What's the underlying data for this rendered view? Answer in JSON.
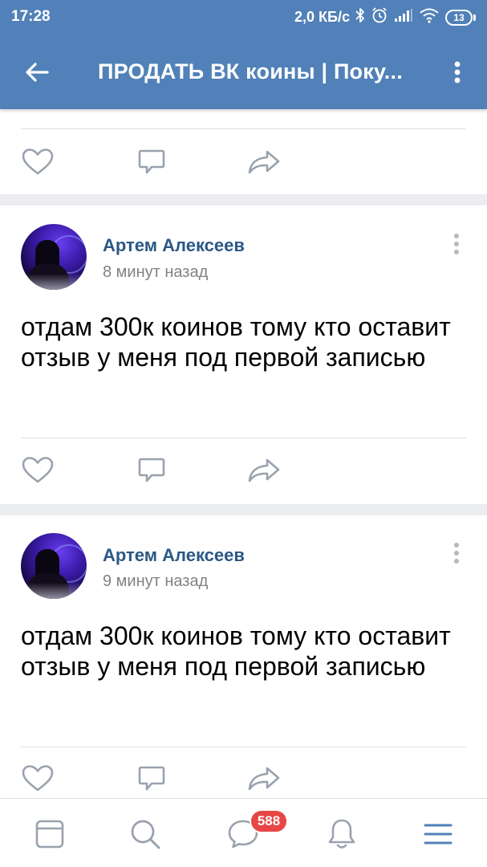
{
  "status_bar": {
    "time": "17:28",
    "network_speed": "2,0 КБ/с",
    "battery_level": "13",
    "icons": [
      "bluetooth-icon",
      "alarm-icon",
      "signal-icon",
      "wifi-icon",
      "battery-icon"
    ]
  },
  "app_bar": {
    "back_icon": "arrow-left-icon",
    "title": "ПРОДАТЬ ВК коины | Поку...",
    "menu_icon": "more-vertical-icon"
  },
  "colors": {
    "app_bar": "#5181b8",
    "author_link": "#2a5885",
    "secondary_text": "#828282",
    "icon_gray": "#99a2ad",
    "nav_active": "#5181b8",
    "badge": "#e64646"
  },
  "posts": [
    {
      "author": "Артем Алексеев",
      "time_ago": "8 минут назад",
      "text": "отдам 300к коинов тому кто оставит отзыв у меня под первой записью"
    },
    {
      "author": "Артем Алексеев",
      "time_ago": "9 минут назад",
      "text": "отдам 300к коинов тому кто оставит отзыв у меня под первой записью"
    }
  ],
  "post_actions": [
    "like-icon",
    "comment-icon",
    "share-icon"
  ],
  "bottom_nav": {
    "items": [
      "news-icon",
      "search-icon",
      "messages-icon",
      "notifications-icon",
      "menu-icon"
    ],
    "messages_badge": "588",
    "active": "menu-icon"
  }
}
